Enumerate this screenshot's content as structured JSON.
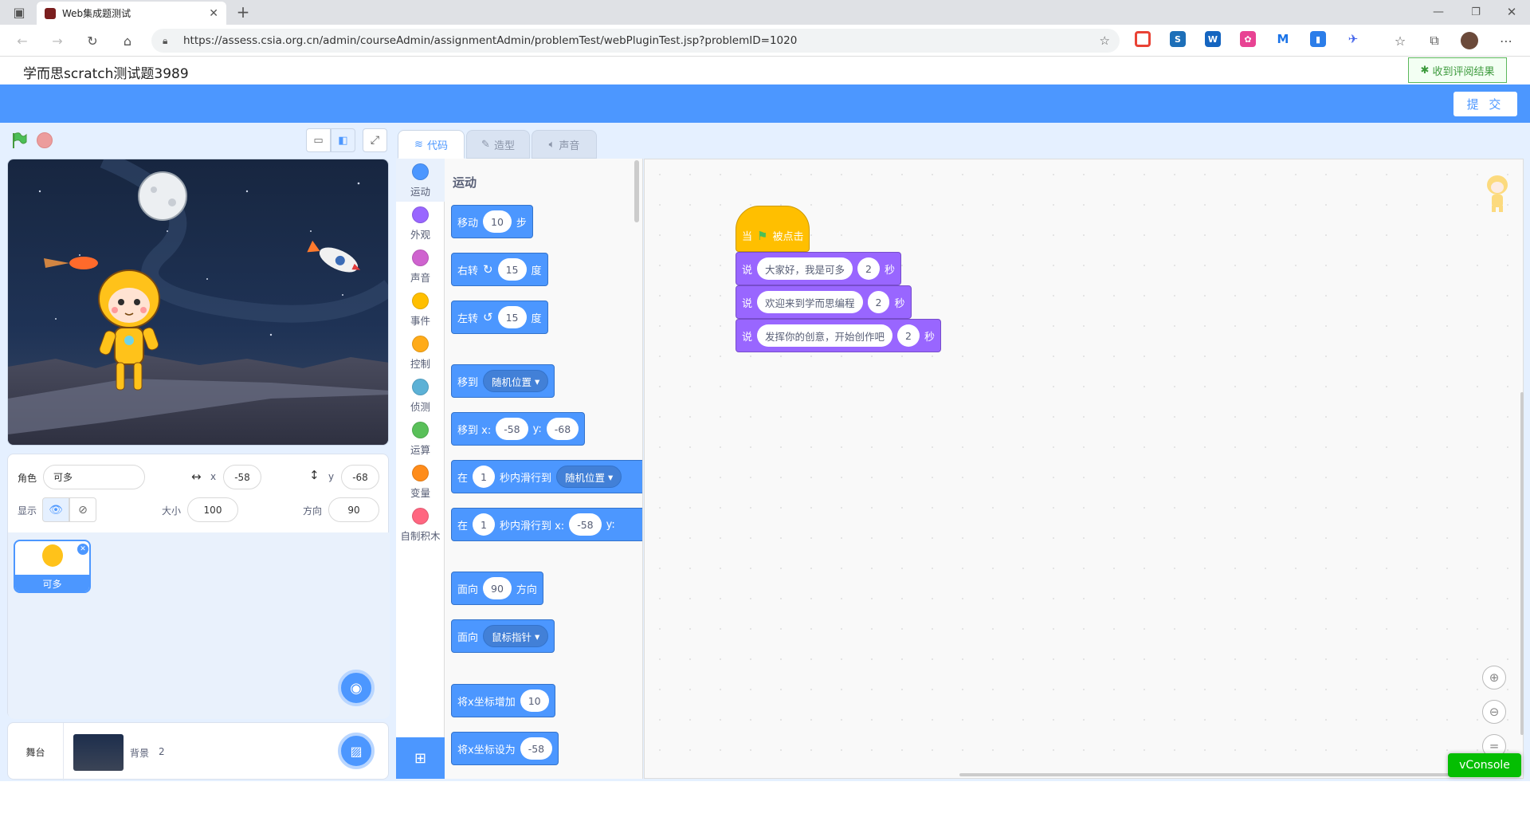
{
  "browser": {
    "tab_title": "Web集成题测试",
    "url": "https://assess.csia.org.cn/admin/courseAdmin/assignmentAdmin/problemTest/webPluginTest.jsp?problemID=1020"
  },
  "page": {
    "title": "学而思scratch测试题3989",
    "result_button": "收到评阅结果",
    "submit_button": "提 交"
  },
  "editor_tabs": [
    "代码",
    "造型",
    "声音"
  ],
  "categories": [
    {
      "label": "运动",
      "color": "#4c97ff"
    },
    {
      "label": "外观",
      "color": "#9966ff"
    },
    {
      "label": "声音",
      "color": "#cf63cf"
    },
    {
      "label": "事件",
      "color": "#ffbf00"
    },
    {
      "label": "控制",
      "color": "#ffab19"
    },
    {
      "label": "侦测",
      "color": "#5cb1d6"
    },
    {
      "label": "运算",
      "color": "#59c059"
    },
    {
      "label": "变量",
      "color": "#ff8c1a"
    },
    {
      "label": "自制积木",
      "color": "#ff6680"
    }
  ],
  "palette": {
    "heading": "运动",
    "blocks": {
      "move": {
        "a": "移动",
        "v": "10",
        "b": "步"
      },
      "turn_right": {
        "a": "右转",
        "v": "15",
        "b": "度"
      },
      "turn_left": {
        "a": "左转",
        "v": "15",
        "b": "度"
      },
      "goto": {
        "a": "移到",
        "d": "随机位置"
      },
      "goto_xy": {
        "a": "移到 x:",
        "x": "-58",
        "y_label": "y:",
        "y": "-68"
      },
      "glide_to": {
        "a": "在",
        "v": "1",
        "b": "秒内滑行到",
        "d": "随机位置"
      },
      "glide_xy": {
        "a": "在",
        "v": "1",
        "b": "秒内滑行到 x:",
        "x": "-58",
        "y_label": "y:"
      },
      "point_dir": {
        "a": "面向",
        "v": "90",
        "b": "方向"
      },
      "point_towards": {
        "a": "面向",
        "d": "鼠标指针"
      },
      "change_x": {
        "a": "将x坐标增加",
        "v": "10"
      },
      "set_x": {
        "a": "将x坐标设为",
        "v": "-58"
      }
    }
  },
  "script": {
    "hat": {
      "a": "当",
      "b": "被点击"
    },
    "says": [
      {
        "a": "说",
        "text": "大家好，我是可多",
        "secs": "2",
        "unit": "秒"
      },
      {
        "a": "说",
        "text": "欢迎来到学而思编程",
        "secs": "2",
        "unit": "秒"
      },
      {
        "a": "说",
        "text": "发挥你的创意，开始创作吧",
        "secs": "2",
        "unit": "秒"
      }
    ]
  },
  "sprite_info": {
    "sprite_label": "角色",
    "sprite_name": "可多",
    "x_label": "x",
    "x": "-58",
    "y_label": "y",
    "y": "-68",
    "show_label": "显示",
    "size_label": "大小",
    "size": "100",
    "dir_label": "方向",
    "direction": "90"
  },
  "sprites": [
    {
      "name": "可多"
    }
  ],
  "stage_panel": {
    "label": "舞台",
    "backdrop_label": "背景",
    "backdrop_count": "2"
  },
  "vconsole": "vConsole"
}
